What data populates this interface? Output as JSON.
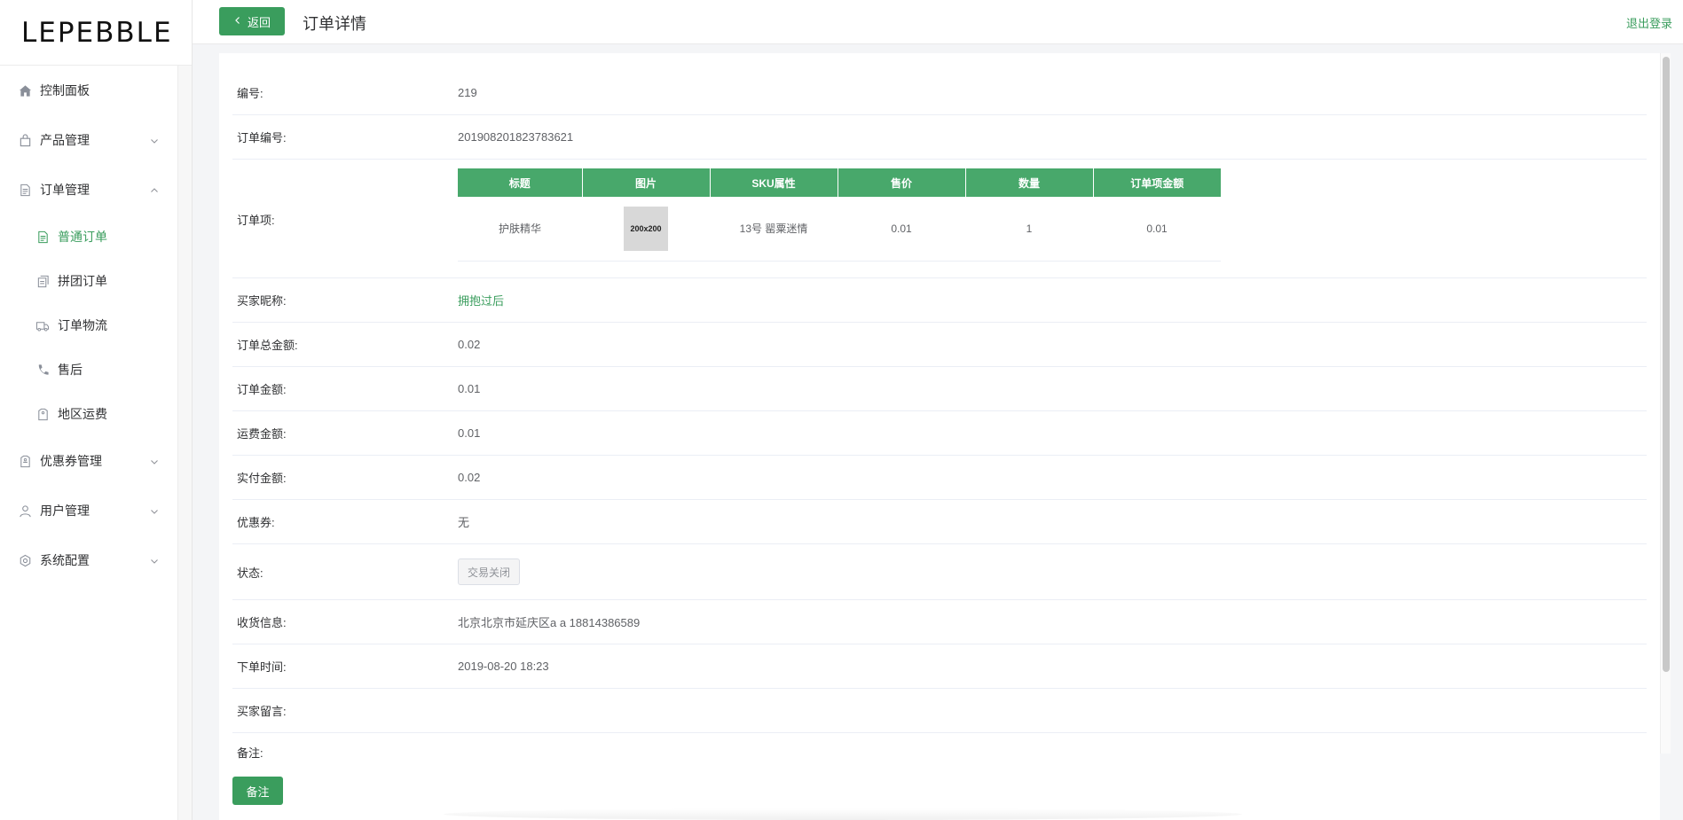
{
  "brand": {
    "logo_text": "LEPEBBLE",
    "accent": "#3a9d5d"
  },
  "sidebar": {
    "items": [
      {
        "label": "控制面板",
        "icon": "home-icon"
      },
      {
        "label": "产品管理",
        "icon": "bag-icon",
        "expandable": true
      },
      {
        "label": "订单管理",
        "icon": "document-icon",
        "expandable": true,
        "expanded": true,
        "children": [
          {
            "label": "普通订单",
            "icon": "document-icon",
            "active": true
          },
          {
            "label": "拼团订单",
            "icon": "copy-icon"
          },
          {
            "label": "订单物流",
            "icon": "truck-icon"
          },
          {
            "label": "售后",
            "icon": "phone-icon"
          },
          {
            "label": "地区运费",
            "icon": "tag-icon"
          }
        ]
      },
      {
        "label": "优惠券管理",
        "icon": "coupon-icon",
        "expandable": true
      },
      {
        "label": "用户管理",
        "icon": "user-icon",
        "expandable": true
      },
      {
        "label": "系统配置",
        "icon": "gear-icon",
        "expandable": true
      }
    ]
  },
  "header": {
    "back_label": "返回",
    "title": "订单详情",
    "logout_label": "退出登录"
  },
  "detail": {
    "id_label": "编号:",
    "id_value": "219",
    "order_no_label": "订单编号:",
    "order_no_value": "201908201823783621",
    "items_label": "订单项:",
    "items_columns": [
      "标题",
      "图片",
      "SKU属性",
      "售价",
      "数量",
      "订单项金额"
    ],
    "items_rows": [
      {
        "title": "护肤精华",
        "image": "200x200",
        "sku": "13号 罂粟迷情",
        "price": "0.01",
        "qty": "1",
        "amount": "0.01"
      }
    ],
    "buyer_label": "买家昵称:",
    "buyer_value": "拥抱过后",
    "total_label": "订单总金额:",
    "total_value": "0.02",
    "order_amount_label": "订单金额:",
    "order_amount_value": "0.01",
    "freight_label": "运费金额:",
    "freight_value": "0.01",
    "paid_label": "实付金额:",
    "paid_value": "0.02",
    "coupon_label": "优惠券:",
    "coupon_value": "无",
    "status_label": "状态:",
    "status_value": "交易关闭",
    "address_label": "收货信息:",
    "address_value": "北京北京市延庆区a a 18814386589",
    "time_label": "下单时间:",
    "time_value": "2019-08-20 18:23",
    "message_label": "买家留言:",
    "message_value": "",
    "remark_label": "备注:"
  },
  "footer": {
    "note_button_label": "备注"
  }
}
